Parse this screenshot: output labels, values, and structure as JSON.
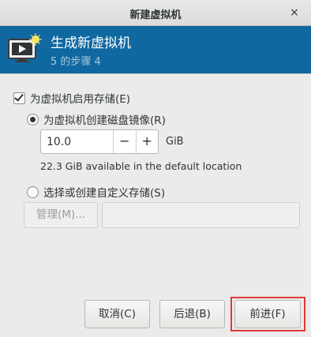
{
  "window": {
    "title": "新建虚拟机",
    "close_glyph": "×"
  },
  "header": {
    "title": "生成新虚拟机",
    "step": "5 的步骤 4",
    "icon": "monitor-icon"
  },
  "storage": {
    "enable_label": "为虚拟机启用存储(E)",
    "enabled": true,
    "option_create_label": "为虚拟机创建磁盘镜像(R)",
    "option_custom_label": "选择或创建自定义存储(S)",
    "selected_option": "create",
    "size_value": "10.0",
    "decrement_glyph": "−",
    "increment_glyph": "+",
    "unit": "GiB",
    "available_text": "22.3 GiB available in the default location",
    "manage_label": "管理(M)...",
    "custom_path_value": ""
  },
  "footer": {
    "cancel_label": "取消(C)",
    "back_label": "后退(B)",
    "forward_label": "前进(F)"
  },
  "colors": {
    "header_bg": "#0f68a0",
    "highlight": "#e03a3a"
  }
}
